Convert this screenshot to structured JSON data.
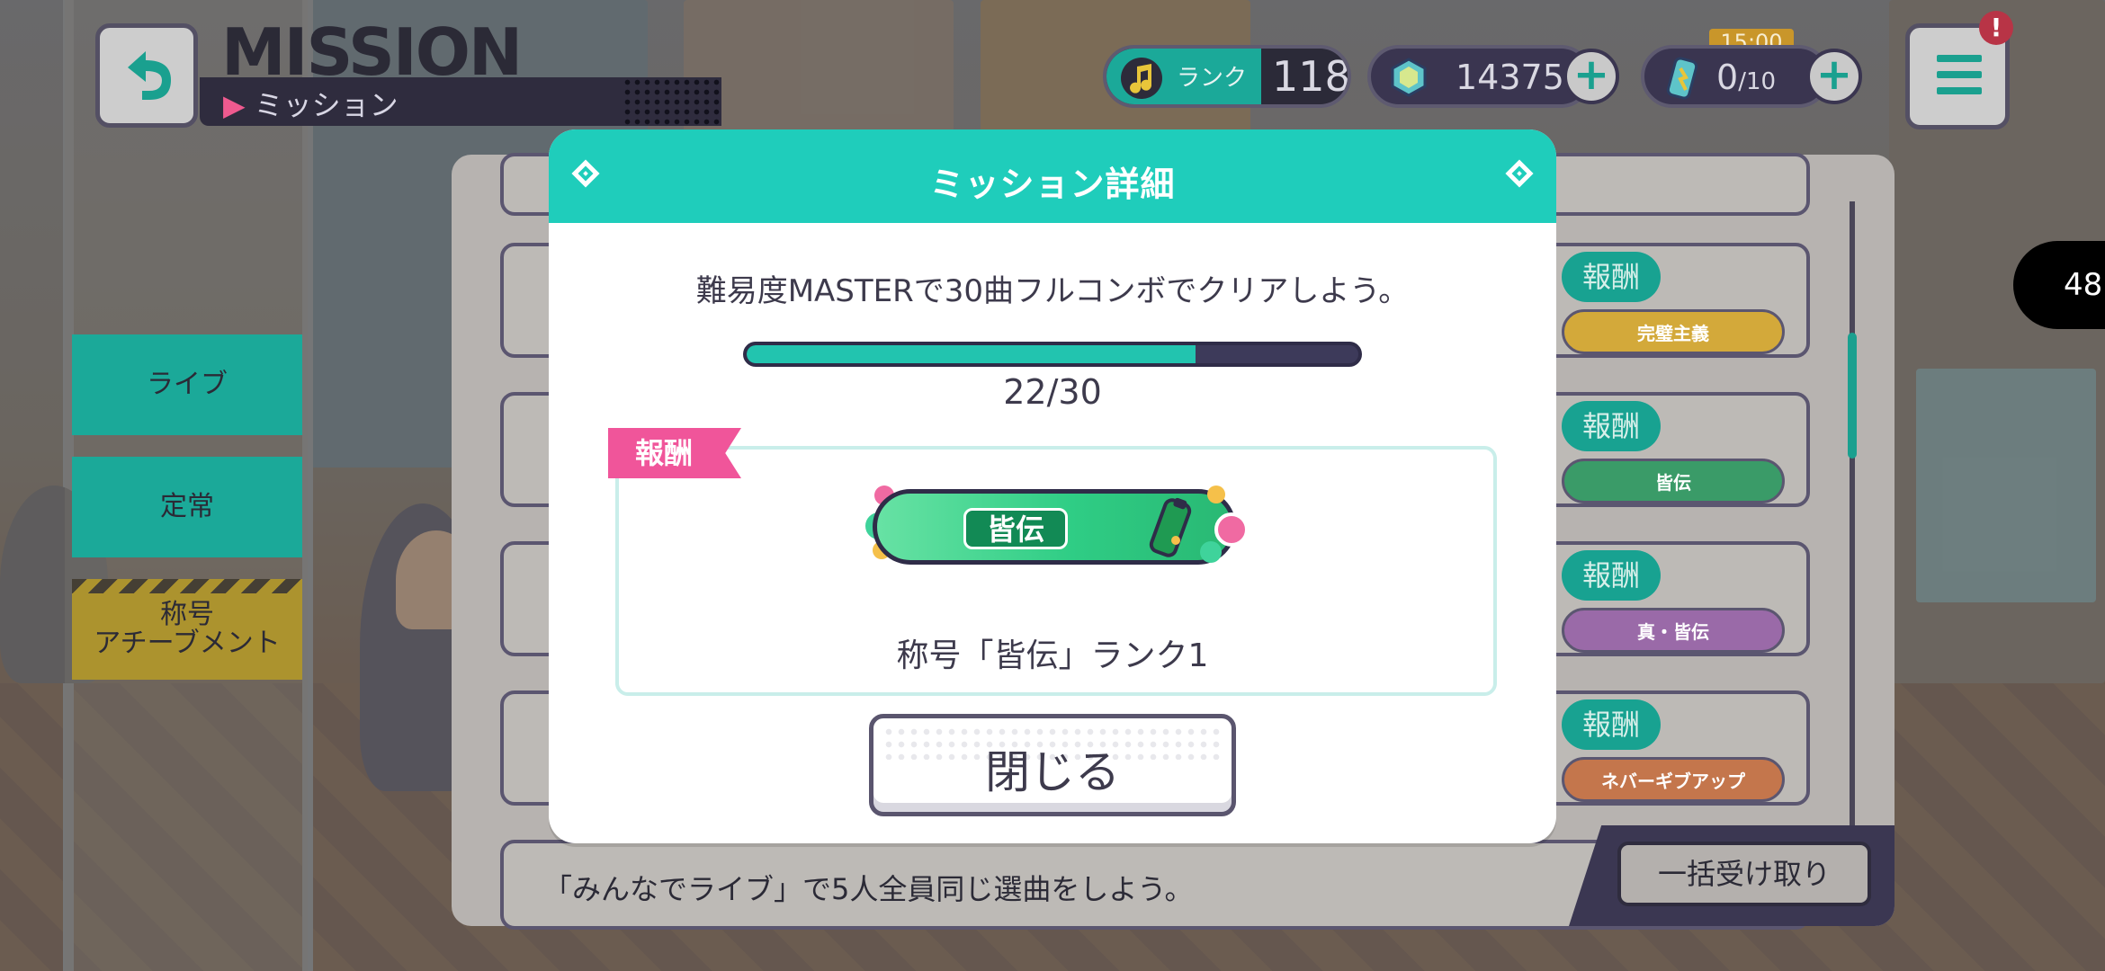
{
  "header": {
    "title_en": "MISSION",
    "title_jp": "ミッション",
    "back_icon": "back-arrow-icon"
  },
  "status": {
    "rank_label": "ランク",
    "rank_value": "118",
    "gems": "14375",
    "energy_current": "0",
    "energy_max": "/10",
    "energy_timer": "15:00",
    "menu_alert": "!",
    "side_counter": "48"
  },
  "tabs": [
    {
      "label": "ライブ"
    },
    {
      "label": "定常"
    },
    {
      "label": "称号\nアチーブメント"
    }
  ],
  "list": {
    "reward_label": "報酬",
    "reward_minis": [
      "完璧主義",
      "皆伝",
      "真・皆伝",
      "ネバーギブアップ"
    ],
    "last_row_text": "「みんなでライブ」で5人全員同じ選曲をしよう。",
    "bulk_button": "一括受け取り"
  },
  "modal": {
    "title": "ミッション詳細",
    "description": "難易度MASTERで30曲フルコンボでクリアしよう。",
    "progress": {
      "current": 22,
      "total": 30,
      "text": "22/30"
    },
    "reward_flag": "報酬",
    "badge_text": "皆伝",
    "reward_name": "称号「皆伝」ランク1",
    "close_button": "閉じる"
  },
  "colors": {
    "accent": "#1fcdbb",
    "reward_pink": "#f0559a",
    "dark": "#3d3a4c"
  }
}
